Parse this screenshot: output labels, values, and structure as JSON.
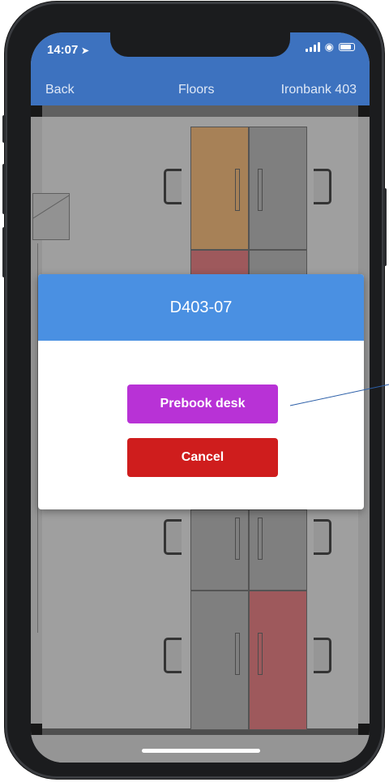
{
  "status_bar": {
    "time": "14:07"
  },
  "navbar": {
    "back_label": "Back",
    "title": "Floors",
    "right_label": "Ironbank 403"
  },
  "modal": {
    "desk_id": "D403-07",
    "prebook_label": "Prebook desk",
    "cancel_label": "Cancel"
  },
  "colors": {
    "header_blue": "#3d72bf",
    "modal_header": "#4a90e2",
    "prebook_purple": "#b832d6",
    "cancel_red": "#cf1d1d",
    "desk_booked_orange": "#ba9061",
    "desk_occupied_red": "#b06467",
    "desk_available_gray": "#8e8e8e"
  },
  "icons": {
    "location_arrow": "location-arrow-icon",
    "signal": "cellular-signal-icon",
    "wifi": "wifi-icon",
    "battery": "battery-icon"
  }
}
